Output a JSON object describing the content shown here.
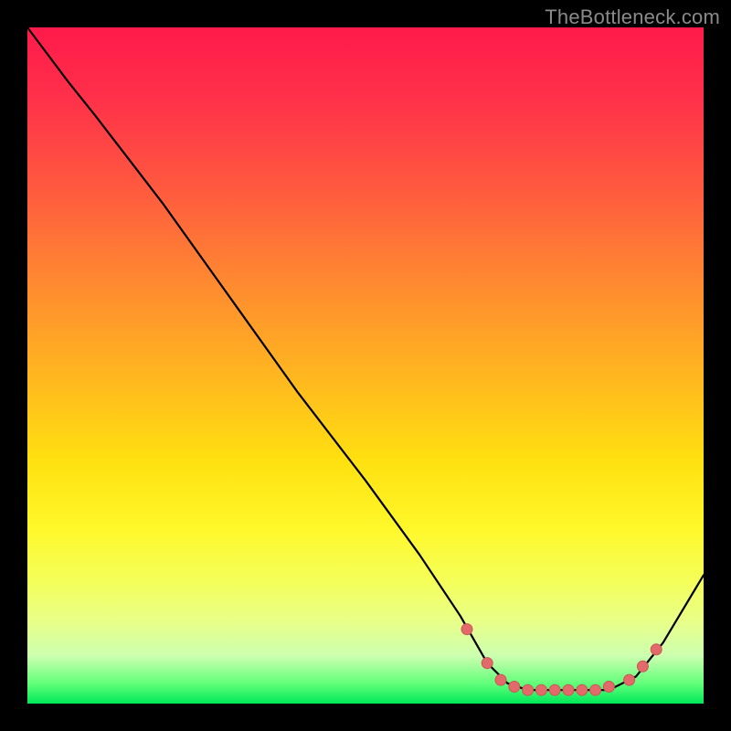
{
  "watermark": "TheBottleneck.com",
  "colors": {
    "marker_fill": "#e26a6a",
    "marker_stroke": "#cc5656",
    "curve_stroke": "#000000"
  },
  "chart_data": {
    "type": "line",
    "xlim": [
      0,
      100
    ],
    "ylim": [
      0,
      100
    ],
    "xlabel": "",
    "ylabel": "",
    "title": "",
    "curve": [
      {
        "x": 0,
        "y": 100
      },
      {
        "x": 6,
        "y": 92
      },
      {
        "x": 10,
        "y": 87
      },
      {
        "x": 20,
        "y": 74
      },
      {
        "x": 30,
        "y": 60
      },
      {
        "x": 40,
        "y": 46
      },
      {
        "x": 50,
        "y": 33
      },
      {
        "x": 58,
        "y": 22
      },
      {
        "x": 64,
        "y": 13
      },
      {
        "x": 68,
        "y": 6
      },
      {
        "x": 71,
        "y": 3
      },
      {
        "x": 74,
        "y": 2
      },
      {
        "x": 80,
        "y": 2
      },
      {
        "x": 86,
        "y": 2
      },
      {
        "x": 90,
        "y": 4
      },
      {
        "x": 94,
        "y": 9
      },
      {
        "x": 100,
        "y": 19
      }
    ],
    "markers": [
      {
        "x": 65,
        "y": 11
      },
      {
        "x": 68,
        "y": 6
      },
      {
        "x": 70,
        "y": 3.5
      },
      {
        "x": 72,
        "y": 2.5
      },
      {
        "x": 74,
        "y": 2
      },
      {
        "x": 76,
        "y": 2
      },
      {
        "x": 78,
        "y": 2
      },
      {
        "x": 80,
        "y": 2
      },
      {
        "x": 82,
        "y": 2
      },
      {
        "x": 84,
        "y": 2
      },
      {
        "x": 86,
        "y": 2.5
      },
      {
        "x": 89,
        "y": 3.5
      },
      {
        "x": 91,
        "y": 5.5
      },
      {
        "x": 93,
        "y": 8
      }
    ]
  }
}
